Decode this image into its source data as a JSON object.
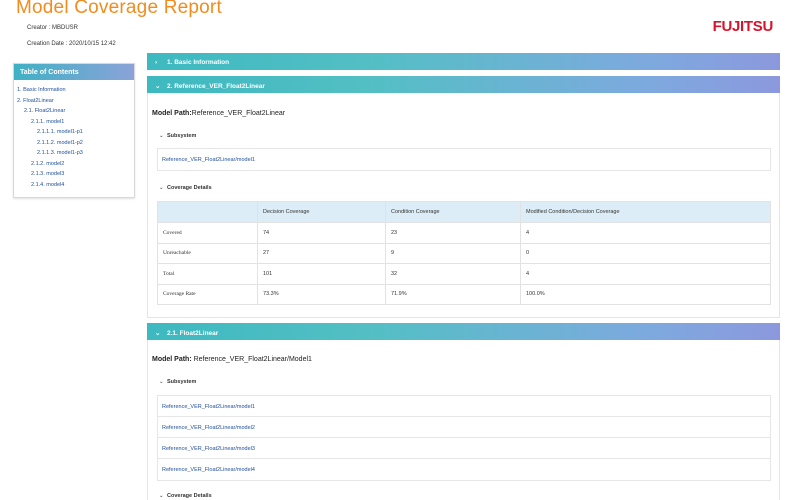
{
  "report": {
    "title": "Model Coverage Report",
    "creator": "Creator : MBDUSR",
    "creation_date": "Creation Date : 2020/10/15 12:42",
    "logo": "FUJITSU"
  },
  "toc": {
    "header": "Table of Contents",
    "items": [
      {
        "label": "1. Basic Information",
        "level": 1
      },
      {
        "label": "2. Float2Linear",
        "level": 1
      },
      {
        "label": "2.1. Float2Linear",
        "level": 2
      },
      {
        "label": "2.1.1. model1",
        "level": 3
      },
      {
        "label": "2.1.1.1. model1-p1",
        "level": 4
      },
      {
        "label": "2.1.1.2. model1-p2",
        "level": 4
      },
      {
        "label": "2.1.1.3. model1-p3",
        "level": 4
      },
      {
        "label": "2.1.2. model2",
        "level": 3
      },
      {
        "label": "2.1.3. model3",
        "level": 3
      },
      {
        "label": "2.1.4. model4",
        "level": 3
      }
    ]
  },
  "sections": {
    "basic": {
      "chevron": "›",
      "label": "1. Basic Information"
    },
    "reference": {
      "chevron": "⌄",
      "label": "2. Reference_VER_Float2Linear"
    },
    "float2linear": {
      "chevron": "⌄",
      "label": "2.1. Float2Linear"
    }
  },
  "panel1": {
    "model_path_label": "Model Path:",
    "model_path_value": "Reference_VER_Float2Linear",
    "subsystem_heading": "Subsystem",
    "subsystems": [
      "Reference_VER_Float2Linear/model1"
    ],
    "coverage_heading": "Coverage Details",
    "table": {
      "headers": [
        "",
        "Decision Coverage",
        "Condition Coverage",
        "Modified Condition/Decision Coverage"
      ],
      "rows": [
        [
          "Covered",
          "74",
          "23",
          "4"
        ],
        [
          "Unreachable",
          "27",
          "9",
          "0"
        ],
        [
          "Total",
          "101",
          "32",
          "4"
        ],
        [
          "Coverage Rate",
          "73.3%",
          "71.9%",
          "100.0%"
        ]
      ]
    }
  },
  "panel2": {
    "model_path_label": "Model Path:",
    "model_path_value": " Reference_VER_Float2Linear/Model1",
    "subsystem_heading": "Subsystem",
    "subsystems": [
      "Reference_VER_Float2Linear/model1",
      "Reference_VER_Float2Linear/model2",
      "Reference_VER_Float2Linear/model3",
      "Reference_VER_Float2Linear/model4"
    ],
    "coverage_heading": "Coverage Details"
  },
  "colors": {
    "title_orange": "#f28c1e",
    "logo_red": "#d7142b",
    "bar_start": "#3db9c0",
    "bar_end": "#8c98dd",
    "link_blue": "#1f4f9a",
    "table_header_bg": "#dcedf7"
  },
  "icons": {
    "expanded": "caret-down-icon",
    "collapsed": "chevron-right-icon"
  }
}
